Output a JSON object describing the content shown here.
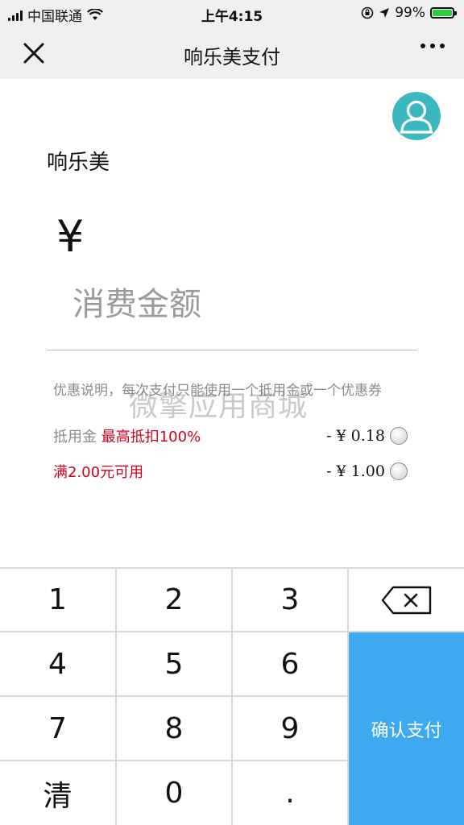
{
  "status_bar": {
    "carrier": "中国联通",
    "time": "上午4:15",
    "battery": "99%",
    "battery_level": 0.99
  },
  "nav": {
    "title": "响乐美支付"
  },
  "merchant": {
    "name": "响乐美"
  },
  "amount": {
    "currency_symbol": "¥",
    "placeholder": "消费金额"
  },
  "promo": {
    "note": "优惠说明，每次支付只能使用一个抵用金或一个优惠券",
    "watermark": "微擎应用商城",
    "options": [
      {
        "label": "抵用金",
        "highlight": "最高抵扣100%",
        "value": "- ¥ 0.18"
      },
      {
        "label": "",
        "highlight": "满2.00元可用",
        "value": "- ¥ 1.00"
      }
    ]
  },
  "keypad": {
    "keys": [
      "1",
      "2",
      "3",
      "4",
      "5",
      "6",
      "7",
      "8",
      "9",
      "清",
      "0",
      "."
    ],
    "confirm": "确认支付"
  },
  "colors": {
    "accent": "#3daaf1",
    "avatar": "#3bb8bf",
    "highlight": "#d0021b"
  }
}
